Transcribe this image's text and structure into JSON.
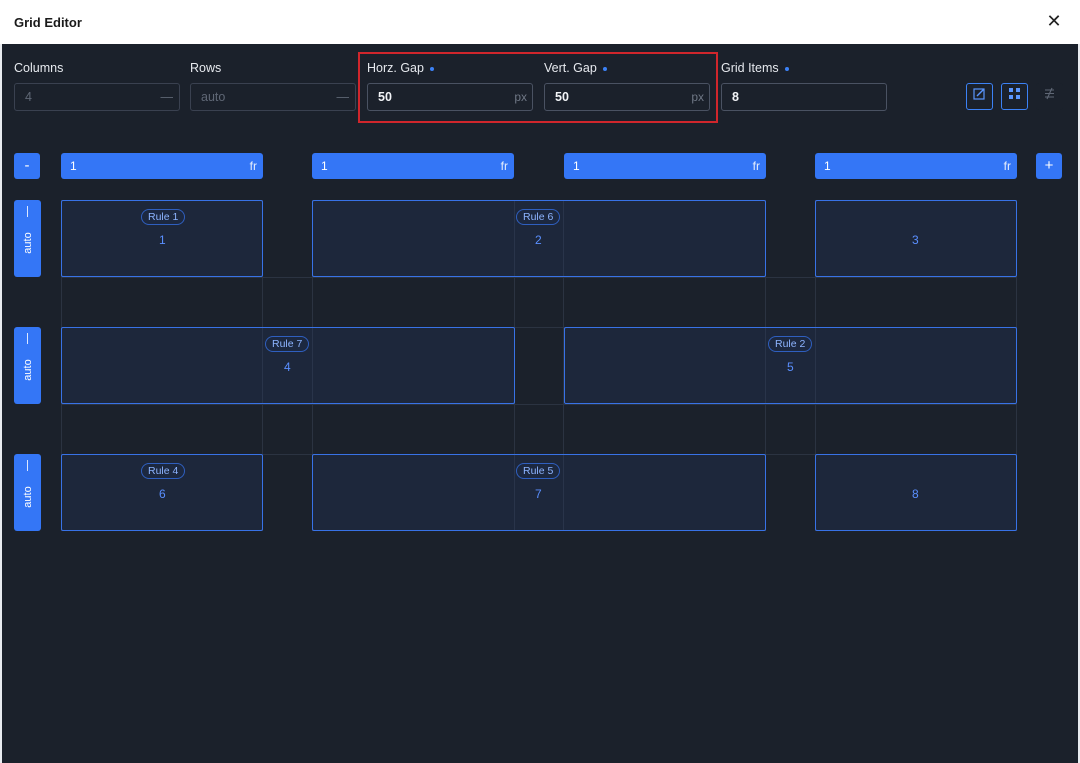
{
  "window": {
    "title": "Grid Editor"
  },
  "fields": {
    "columns": {
      "label": "Columns",
      "value": "4"
    },
    "rows": {
      "label": "Rows",
      "value": "auto"
    },
    "horz_gap": {
      "label": "Horz. Gap",
      "value": "50",
      "unit": "px"
    },
    "vert_gap": {
      "label": "Vert. Gap",
      "value": "50",
      "unit": "px"
    },
    "grid_items": {
      "label": "Grid Items",
      "value": "8"
    }
  },
  "columns": [
    {
      "value": "1",
      "unit": "fr"
    },
    {
      "value": "1",
      "unit": "fr"
    },
    {
      "value": "1",
      "unit": "fr"
    },
    {
      "value": "1",
      "unit": "fr"
    }
  ],
  "column_controls": {
    "remove": "-",
    "add": "+"
  },
  "rows": [
    {
      "label": "auto"
    },
    {
      "label": "auto"
    },
    {
      "label": "auto"
    }
  ],
  "items": [
    {
      "rule": "Rule 1",
      "number": "1"
    },
    {
      "rule": "Rule 6",
      "number": "2"
    },
    {
      "rule": "",
      "number": "3"
    },
    {
      "rule": "Rule 7",
      "number": "4"
    },
    {
      "rule": "Rule 2",
      "number": "5"
    },
    {
      "rule": "Rule 4",
      "number": "6"
    },
    {
      "rule": "Rule 5",
      "number": "7"
    },
    {
      "rule": "",
      "number": "8"
    }
  ],
  "colors": {
    "accent": "#3476f6",
    "highlight": "#d0262c",
    "background": "#1b212b"
  }
}
